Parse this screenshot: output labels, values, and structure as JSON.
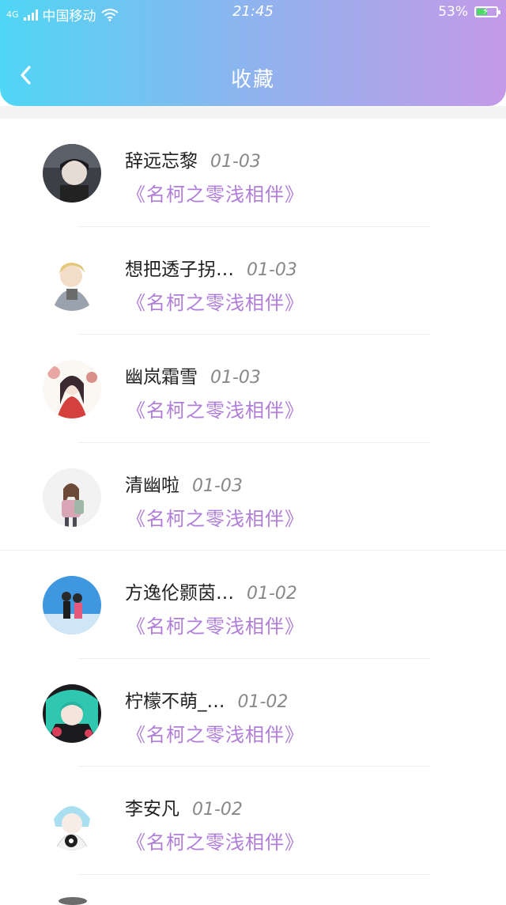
{
  "status": {
    "network": "4G",
    "carrier": "中国移动",
    "time": "21:45",
    "battery_text": "53%",
    "battery_level": 0.53
  },
  "header": {
    "title": "收藏"
  },
  "items": [
    {
      "name": "辞远忘黎",
      "date": "01-03",
      "book": "《名柯之零浅相伴》"
    },
    {
      "name": "想把透子拐…",
      "date": "01-03",
      "book": "《名柯之零浅相伴》"
    },
    {
      "name": "幽岚霜雪",
      "date": "01-03",
      "book": "《名柯之零浅相伴》"
    },
    {
      "name": "清幽啦",
      "date": "01-03",
      "book": "《名柯之零浅相伴》"
    },
    {
      "name": "方逸伦颢茵…",
      "date": "01-02",
      "book": "《名柯之零浅相伴》"
    },
    {
      "name": "柠檬不萌_…",
      "date": "01-02",
      "book": "《名柯之零浅相伴》"
    },
    {
      "name": "李安凡",
      "date": "01-02",
      "book": "《名柯之零浅相伴》"
    }
  ],
  "colors": {
    "header_start": "#4fd6f4",
    "header_end": "#c49ae8",
    "book_title": "#b07ed9"
  }
}
